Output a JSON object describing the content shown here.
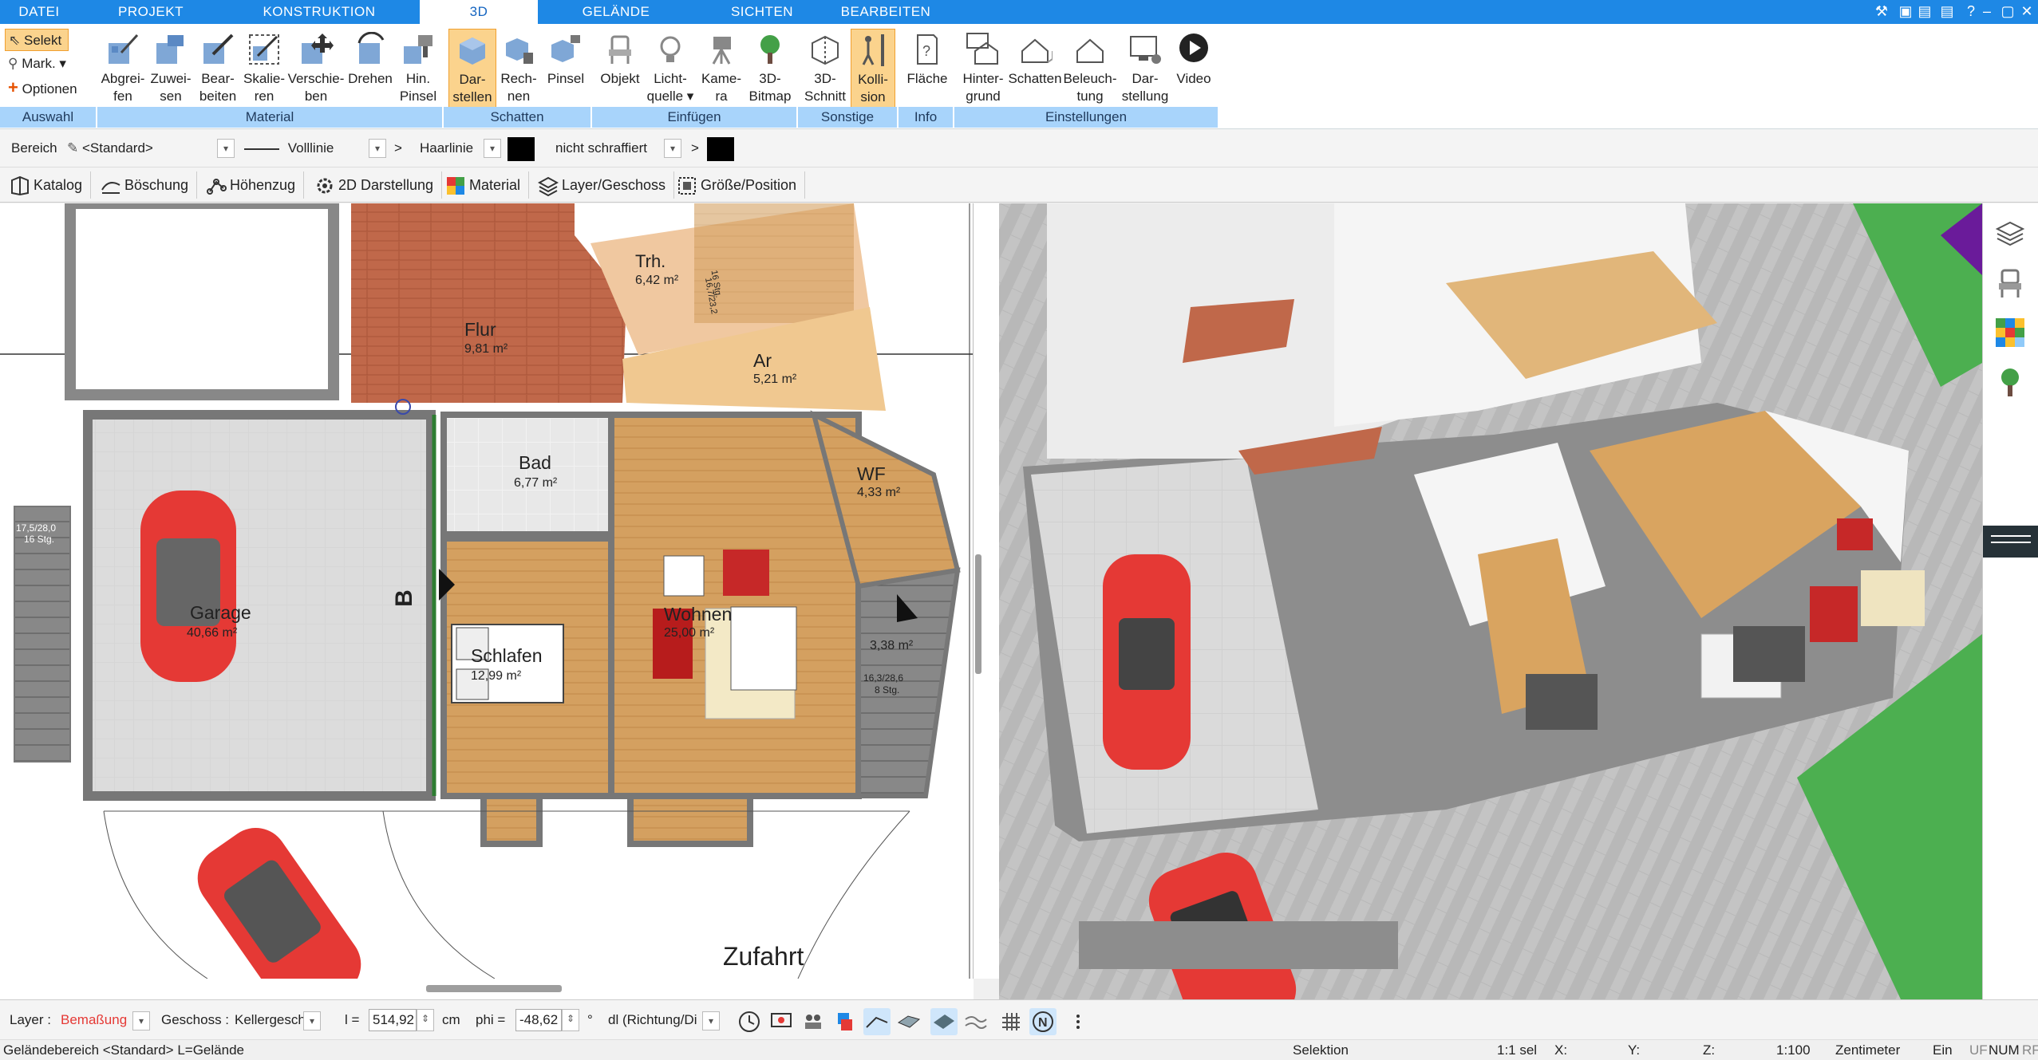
{
  "menu": {
    "tabs": [
      {
        "label": "DATEI"
      },
      {
        "label": "PROJEKT"
      },
      {
        "label": "KONSTRUKTION"
      },
      {
        "label": "3D"
      },
      {
        "label": "GELÄNDE"
      },
      {
        "label": "SICHTEN"
      },
      {
        "label": "BEARBEITEN"
      }
    ],
    "active_tab": "3D"
  },
  "ribbon": {
    "auswahl": {
      "selekt": "Selekt",
      "mark": "Mark.",
      "optionen": "Optionen",
      "group": "Auswahl"
    },
    "material": {
      "buttons": [
        {
          "l1": "Abgrei-",
          "l2": "fen"
        },
        {
          "l1": "Zuwei-",
          "l2": "sen"
        },
        {
          "l1": "Bear-",
          "l2": "beiten"
        },
        {
          "l1": "Skalie-",
          "l2": "ren"
        },
        {
          "l1": "Verschie-",
          "l2": "ben"
        },
        {
          "l1": "Drehen",
          "l2": ""
        },
        {
          "l1": "Hin.",
          "l2": "Pinsel"
        }
      ],
      "group": "Material"
    },
    "schatten": {
      "buttons": [
        {
          "l1": "Dar-",
          "l2": "stellen"
        },
        {
          "l1": "Rech-",
          "l2": "nen"
        },
        {
          "l1": "Pinsel",
          "l2": ""
        }
      ],
      "group": "Schatten"
    },
    "einfuegen": {
      "buttons": [
        {
          "l1": "Objekt",
          "l2": ""
        },
        {
          "l1": "Licht-",
          "l2": "quelle"
        },
        {
          "l1": "Kame-",
          "l2": "ra"
        },
        {
          "l1": "3D-",
          "l2": "Bitmap"
        }
      ],
      "group": "Einfügen"
    },
    "sonstige": {
      "buttons": [
        {
          "l1": "3D-",
          "l2": "Schnitt"
        },
        {
          "l1": "Kolli-",
          "l2": "sion"
        }
      ],
      "group": "Sonstige"
    },
    "info": {
      "buttons": [
        {
          "l1": "Fläche",
          "l2": ""
        }
      ],
      "group": "Info"
    },
    "einstellungen": {
      "buttons": [
        {
          "l1": "Hinter-",
          "l2": "grund"
        },
        {
          "l1": "Schatten",
          "l2": ""
        },
        {
          "l1": "Beleuch-",
          "l2": "tung"
        },
        {
          "l1": "Dar-",
          "l2": "stellung"
        },
        {
          "l1": "Video",
          "l2": ""
        }
      ],
      "group": "Einstellungen"
    }
  },
  "propbar": {
    "bereich_label": "Bereich",
    "bereich_value": "<Standard>",
    "line_style": "Volllinie",
    "line_type": "Haarlinie",
    "hatch": "nicht schraffiert",
    "line_color": "#000000",
    "fill_color": "#000000"
  },
  "toolbar2": {
    "items": [
      {
        "label": "Katalog",
        "icon": "book-icon"
      },
      {
        "label": "Böschung",
        "icon": "slope-icon"
      },
      {
        "label": "Höhenzug",
        "icon": "ridge-icon"
      },
      {
        "label": "2D Darstellung",
        "icon": "gear-icon"
      },
      {
        "label": "Material",
        "icon": "palette-icon"
      },
      {
        "label": "Layer/Geschoss",
        "icon": "layers-icon"
      },
      {
        "label": "Größe/Position",
        "icon": "resize-icon"
      }
    ]
  },
  "plan": {
    "rooms": [
      {
        "name": "Trh.",
        "area": "6,42 m²"
      },
      {
        "name": "Flur",
        "area": "9,81 m²"
      },
      {
        "name": "Ar",
        "area": "5,21 m²"
      },
      {
        "name": "Bad",
        "area": "6,77 m²"
      },
      {
        "name": "WF",
        "area": "4,33 m²"
      },
      {
        "name": "Garage",
        "area": "40,66 m²"
      },
      {
        "name": "Wohnen",
        "area": "25,00 m²"
      },
      {
        "name": "Schlafen",
        "area": "12,99 m²"
      },
      {
        "name": "",
        "area": "3,38 m²"
      }
    ],
    "stair_label_1": "16,7/23,2",
    "stair_label_1b": "16 Stg.",
    "stair_label_2": "17,5/28,0",
    "stair_label_2b": "16 Stg.",
    "stair_label_3": "16,3/28,6",
    "stair_label_3b": "8 Stg.",
    "section_marker": "B",
    "zufahrt": "Zufahrt"
  },
  "bottombar": {
    "layer_label": "Layer :",
    "layer_value": "Bemaßung",
    "geschoss_label": "Geschoss :",
    "geschoss_value": "Kellergesch",
    "l_label": "l =",
    "l_value": "514,92",
    "l_unit": "cm",
    "phi_label": "phi =",
    "phi_value": "-48,62",
    "phi_unit": "°",
    "dl_value": "dl (Richtung/Di",
    "layer_color": "#e53935"
  },
  "statusbar": {
    "left": "Geländebereich <Standard> L=Gelände",
    "mode": "Selektion",
    "sel": "1:1 sel",
    "x": "X:",
    "y": "Y:",
    "z": "Z:",
    "scale": "1:100",
    "unit": "Zentimeter",
    "ein": "Ein",
    "uf": "UF",
    "num": "NUM",
    "rf": "RF"
  }
}
